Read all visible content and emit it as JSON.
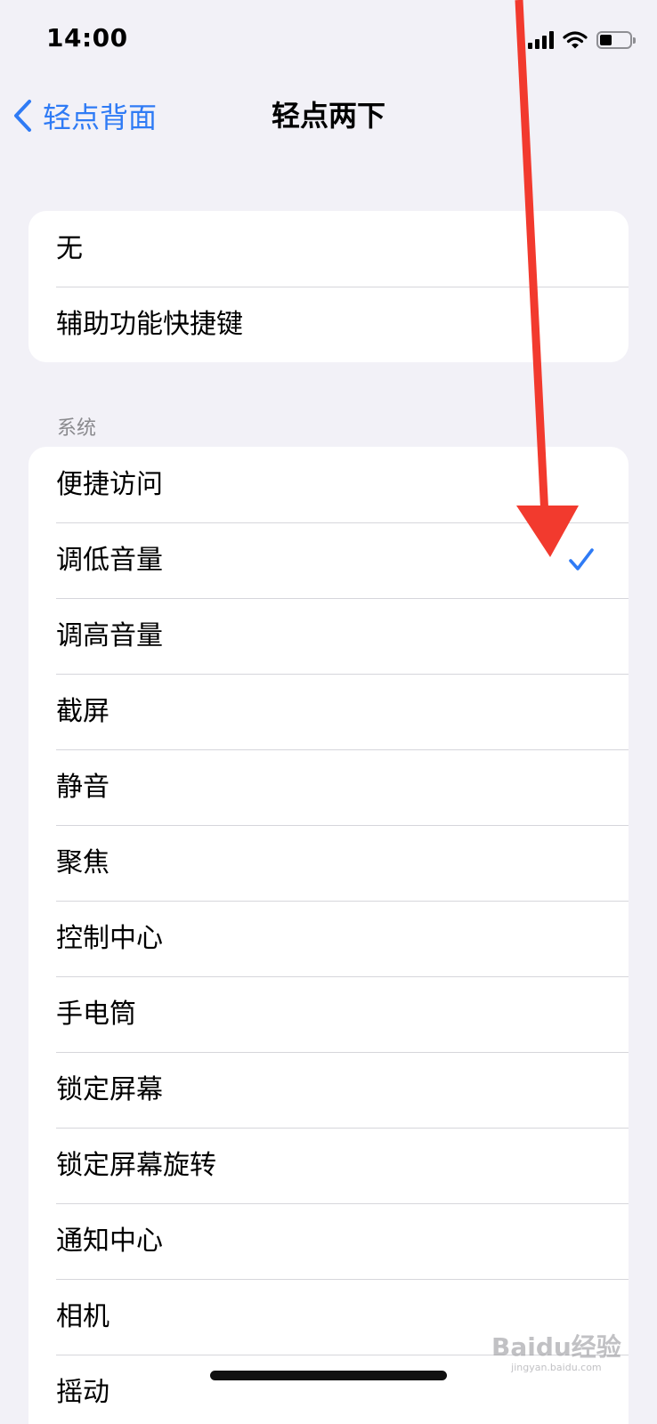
{
  "status_bar": {
    "time": "14:00",
    "battery_level": 0.4
  },
  "nav": {
    "back_label": "轻点背面",
    "title": "轻点两下"
  },
  "top_group": {
    "items": [
      {
        "label": "无"
      },
      {
        "label": "辅助功能快捷键"
      }
    ]
  },
  "system_section": {
    "header": "系统",
    "items": [
      {
        "label": "便捷访问",
        "selected": false
      },
      {
        "label": "调低音量",
        "selected": true
      },
      {
        "label": "调高音量",
        "selected": false
      },
      {
        "label": "截屏",
        "selected": false
      },
      {
        "label": "静音",
        "selected": false
      },
      {
        "label": "聚焦",
        "selected": false
      },
      {
        "label": "控制中心",
        "selected": false
      },
      {
        "label": "手电筒",
        "selected": false
      },
      {
        "label": "锁定屏幕",
        "selected": false
      },
      {
        "label": "锁定屏幕旋转",
        "selected": false
      },
      {
        "label": "通知中心",
        "selected": false
      },
      {
        "label": "相机",
        "selected": false
      },
      {
        "label": "摇动",
        "selected": false
      }
    ]
  },
  "watermark": {
    "brand": "Baidu经验",
    "url": "jingyan.baidu.com"
  },
  "colors": {
    "accent": "#2f7bf5",
    "background": "#f2f1f7",
    "annotation": "#f23a2e"
  },
  "icons": {
    "back": "chevron-left-icon",
    "selected": "checkmark-icon",
    "signal": "cellular-signal-icon",
    "wifi": "wifi-icon",
    "battery": "battery-icon"
  }
}
